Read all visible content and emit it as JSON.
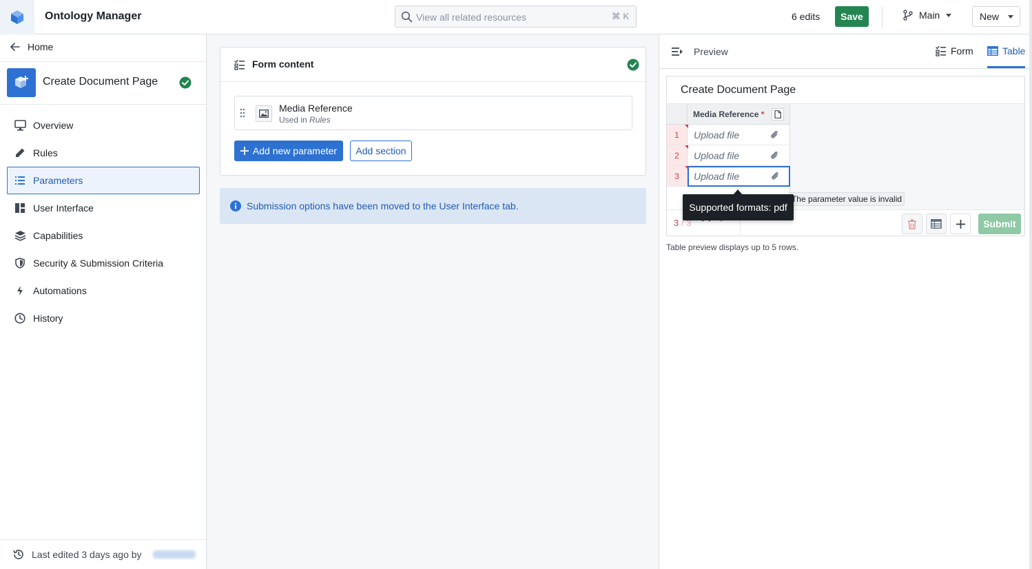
{
  "app": {
    "title": "Ontology Manager",
    "logo_icon": "cube-icon"
  },
  "header": {
    "search_placeholder": "View all related resources",
    "search_shortcut": "⌘ K",
    "edits_label": "6 edits",
    "save_label": "Save",
    "branch_label": "Main",
    "new_label": "New"
  },
  "sidebar": {
    "home_label": "Home",
    "resource_name": "Create Document Page",
    "items": [
      {
        "label": "Overview",
        "icon": "monitor-icon"
      },
      {
        "label": "Rules",
        "icon": "pencil-icon"
      },
      {
        "label": "Parameters",
        "icon": "list-icon",
        "active": true
      },
      {
        "label": "User Interface",
        "icon": "layout-icon"
      },
      {
        "label": "Capabilities",
        "icon": "layers-icon"
      },
      {
        "label": "Security & Submission Criteria",
        "icon": "shield-icon"
      },
      {
        "label": "Automations",
        "icon": "lightning-icon"
      },
      {
        "label": "History",
        "icon": "clock-icon"
      }
    ],
    "footer_text": "Last edited 3 days ago by"
  },
  "form": {
    "title": "Form content",
    "parameter": {
      "name": "Media Reference",
      "used_in_prefix": "Used in ",
      "used_in_target": "Rules"
    },
    "add_parameter_label": "Add new parameter",
    "add_section_label": "Add section",
    "info_text": "Submission options have been moved to the User Interface tab."
  },
  "preview": {
    "label": "Preview",
    "tabs": [
      {
        "label": "Form",
        "active": false
      },
      {
        "label": "Table",
        "active": true
      }
    ],
    "card_title": "Create Document Page",
    "column_header": "Media Reference",
    "required_mark": "*",
    "rows": [
      {
        "num": "1",
        "value": "Upload file"
      },
      {
        "num": "2",
        "value": "Upload file"
      },
      {
        "num": "3",
        "value": "Upload file"
      }
    ],
    "row_counter_current": "3",
    "row_counter_sep": " / ",
    "row_counter_total": "3",
    "submit_label": "Submit",
    "note": "Table preview displays up to 5 rows.",
    "tooltip_formats": "Supported formats: pdf",
    "tooltip_invalid": "The parameter value is invalid"
  },
  "colors": {
    "primary": "#2d72d2",
    "success": "#238551",
    "danger": "#cd4246",
    "info_bg": "#dbe6f5"
  }
}
